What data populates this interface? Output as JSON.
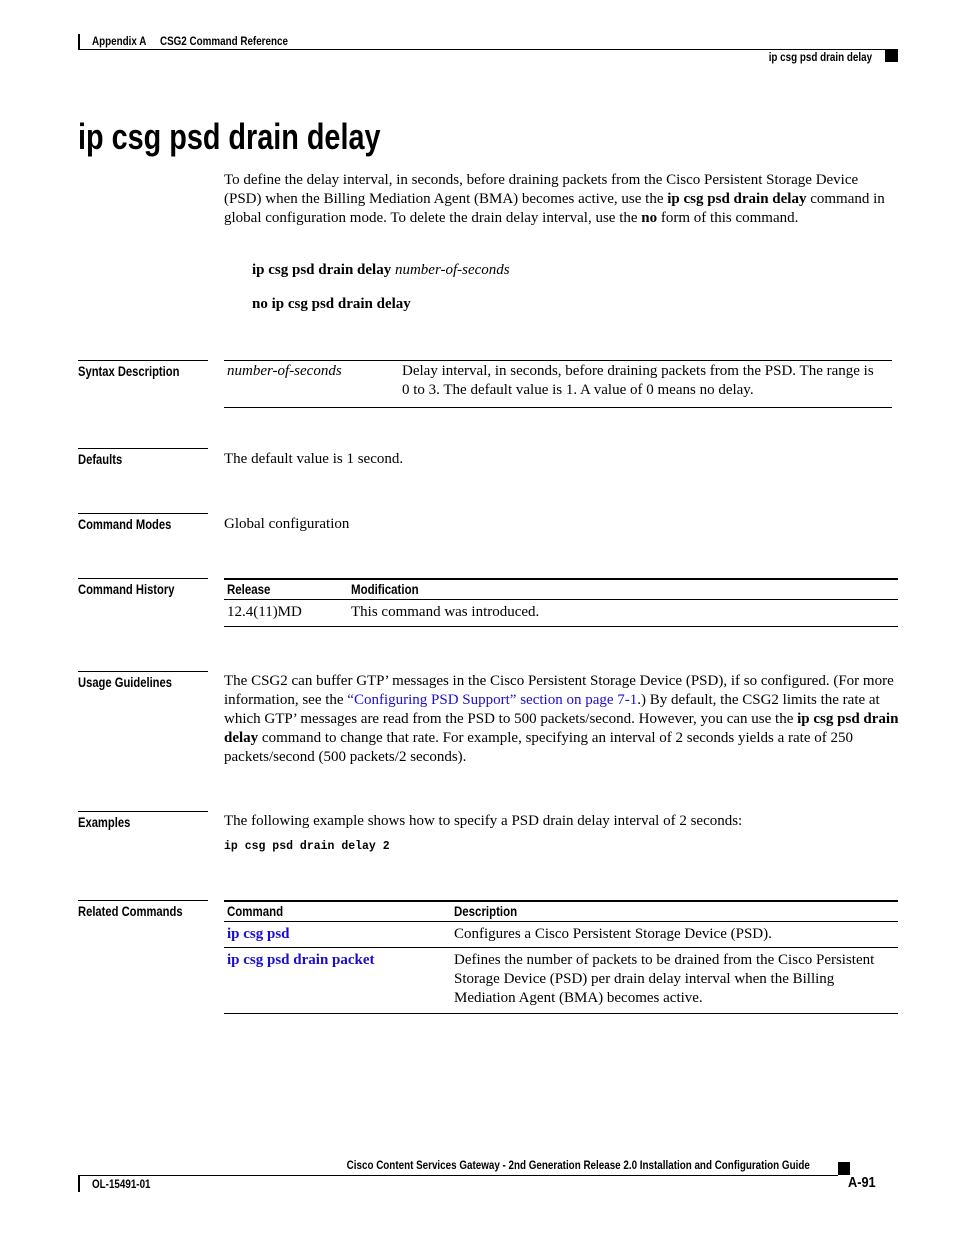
{
  "header": {
    "appendix": "Appendix A",
    "chapter": "CSG2 Command Reference",
    "running_title": "ip csg psd drain delay"
  },
  "title": "ip csg psd drain delay",
  "intro": {
    "p1": "To define the delay interval, in seconds, before draining packets from the Cisco Persistent Storage Device (PSD) when the Billing Mediation Agent (BMA) becomes active, use the ",
    "p1_bold": "ip csg psd drain delay",
    "p2": " command in global configuration mode. To delete the drain delay interval, use the ",
    "p2_bold": "no",
    "p3": " form of this command."
  },
  "syntax": {
    "cmd_bold": "ip csg psd drain delay",
    "cmd_arg": "number-of-seconds",
    "no_form": "no ip csg psd drain delay"
  },
  "sections": {
    "syntax_description": "Syntax Description",
    "defaults": "Defaults",
    "command_modes": "Command Modes",
    "command_history": "Command History",
    "usage_guidelines": "Usage Guidelines",
    "examples": "Examples",
    "related_commands": "Related Commands"
  },
  "syntax_description": {
    "arg": "number-of-seconds",
    "desc": "Delay interval, in seconds, before draining packets from the PSD. The range is 0 to 3. The default value is 1. A value of 0 means no delay."
  },
  "defaults": "The default value is 1 second.",
  "command_modes": "Global configuration",
  "command_history": {
    "headers": [
      "Release",
      "Modification"
    ],
    "rows": [
      [
        "12.4(11)MD",
        "This command was introduced."
      ]
    ]
  },
  "usage": {
    "t1": "The CSG2 can buffer GTP’ messages in the Cisco Persistent Storage Device (PSD), if so configured. (For more information, see the ",
    "link": "“Configuring PSD Support” section on page 7-1",
    "t2": ".) By default, the CSG2 limits the rate at which GTP’ messages are read from the PSD to 500 packets/second. However, you can use the ",
    "bold": "ip csg psd drain delay",
    "t3": " command to change that rate. For example, specifying an interval of 2 seconds yields a rate of 250 packets/second (500 packets/2 seconds)."
  },
  "examples": {
    "text": "The following example shows how to specify a PSD drain delay interval of 2 seconds:",
    "code": "ip csg psd drain delay 2"
  },
  "related_commands": {
    "headers": [
      "Command",
      "Description"
    ],
    "rows": [
      [
        "ip csg psd",
        "Configures a Cisco Persistent Storage Device (PSD)."
      ],
      [
        "ip csg psd drain packet",
        "Defines the number of packets to be drained from the Cisco Persistent Storage Device (PSD) per drain delay interval when the Billing Mediation Agent (BMA) becomes active."
      ]
    ]
  },
  "footer": {
    "guide_title": "Cisco Content Services Gateway - 2nd Generation Release 2.0 Installation and Configuration Guide",
    "doc_number": "OL-15491-01",
    "page": "A-91"
  },
  "colors": {
    "link": "#1a0dcc"
  }
}
